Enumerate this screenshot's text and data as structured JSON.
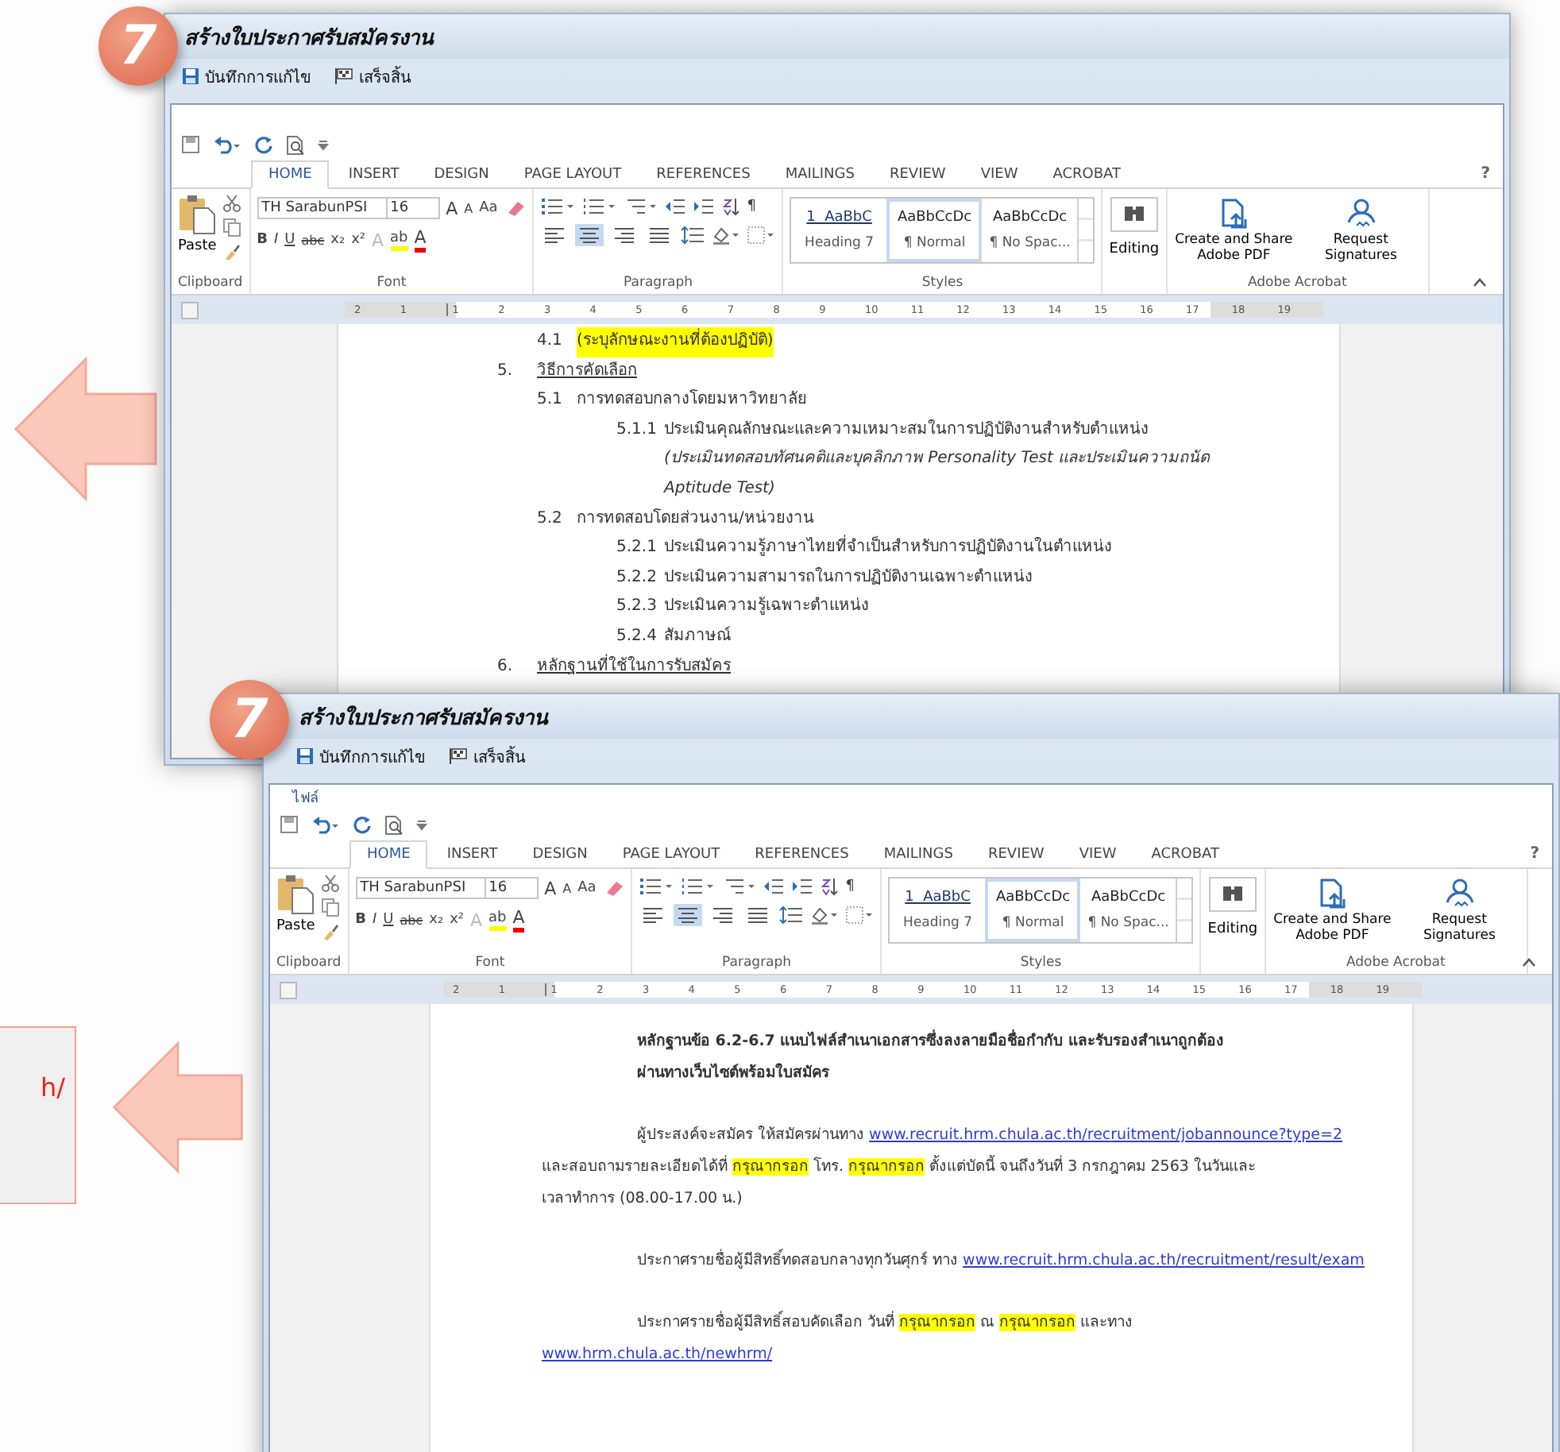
{
  "windows": [
    {
      "step": "7",
      "title": "สร้างใบประกาศรับสมัครงาน",
      "actions": [
        {
          "kind": "save",
          "label": "บันทึกการแก้ไข"
        },
        {
          "kind": "finish",
          "label": "เสร็จสิ้น"
        }
      ],
      "ribbon": {
        "help": "?",
        "tabs": [
          {
            "label": "HOME",
            "selected": true
          },
          {
            "label": "INSERT",
            "selected": false
          },
          {
            "label": "DESIGN",
            "selected": false
          },
          {
            "label": "PAGE LAYOUT",
            "selected": false
          },
          {
            "label": "REFERENCES",
            "selected": false
          },
          {
            "label": "MAILINGS",
            "selected": false
          },
          {
            "label": "REVIEW",
            "selected": false
          },
          {
            "label": "VIEW",
            "selected": false
          },
          {
            "label": "ACROBAT",
            "selected": false
          }
        ],
        "paste": "Paste",
        "font_name": "TH SarabunPSI",
        "font_size": "16",
        "grow_shrink": [
          "A",
          "A"
        ],
        "case_button": "Aa",
        "format_buttons": [
          "B",
          "I",
          "U",
          "abc",
          "x₂",
          "x²"
        ],
        "text_effects": "A",
        "highlight": "ab",
        "font_color": "A",
        "pilcrow": "¶",
        "align_buttons": [
          {
            "kind": "left",
            "selected": false
          },
          {
            "kind": "center",
            "selected": true
          },
          {
            "kind": "right",
            "selected": false
          },
          {
            "kind": "justify",
            "selected": false
          }
        ],
        "styles": [
          {
            "sample": "1  AaBbC",
            "name": "Heading 7",
            "selected": false
          },
          {
            "sample": "AaBbCcDc",
            "name": "¶ Normal",
            "selected": true
          },
          {
            "sample": "AaBbCcDc",
            "name": "¶ No Spac...",
            "selected": false
          }
        ],
        "editing": "Editing",
        "acrobat": [
          {
            "kind": "pdf",
            "label": "Create and Share Adobe PDF"
          },
          {
            "kind": "sign",
            "label": "Request Signatures"
          }
        ],
        "groups": [
          "Clipboard",
          "Font",
          "Paragraph",
          "Styles",
          "Adobe Acrobat"
        ],
        "ruler": [
          "2",
          "1",
          "1",
          "2",
          "3",
          "4",
          "5",
          "6",
          "7",
          "8",
          "9",
          "10",
          "11",
          "12",
          "13",
          "14",
          "15",
          "16",
          "17",
          "18",
          "19"
        ]
      },
      "document": {
        "kind": "outline",
        "items": [
          {
            "children": [
              {
                "num": "4.1",
                "text": "(ระบุลักษณะงานที่ต้องปฏิบัติ)",
                "highlight": true
              }
            ]
          },
          {
            "num": "5.",
            "text": "วิธีการคัดเลือก",
            "underline": true,
            "children": [
              {
                "num": "5.1",
                "text": "การทดสอบกลางโดยมหาวิทยาลัย",
                "highlight": false,
                "children": [
                  {
                    "num": "5.1.1",
                    "text": "ประเมินคุณลักษณะและความเหมาะสมในการปฏิบัติงานสำหรับตำแหน่ง",
                    "note": "(ประเมินทดสอบทัศนคติและบุคลิกภาพ Personality Test และประเมินความถนัด Aptitude Test)"
                  }
                ]
              },
              {
                "num": "5.2",
                "text": "การทดสอบโดยส่วนงาน/หน่วยงาน",
                "highlight": false,
                "children": [
                  {
                    "num": "5.2.1",
                    "text": "ประเมินความรู้ภาษาไทยที่จำเป็นสำหรับการปฏิบัติงานในตำแหน่ง"
                  },
                  {
                    "num": "5.2.2",
                    "text": "ประเมินความสามารถในการปฏิบัติงานเฉพาะตำแหน่ง"
                  },
                  {
                    "num": "5.2.3",
                    "text": "ประเมินความรู้เฉพาะตำแหน่ง"
                  },
                  {
                    "num": "5.2.4",
                    "text": "สัมภาษณ์"
                  }
                ]
              }
            ]
          },
          {
            "num": "6.",
            "text": "หลักฐานที่ใช้ในการรับสมัคร",
            "underline": true
          }
        ]
      }
    },
    {
      "step": "7",
      "title": "สร้างใบประกาศรับสมัครงาน",
      "actions": [
        {
          "kind": "save",
          "label": "บันทึกการแก้ไข"
        },
        {
          "kind": "finish",
          "label": "เสร็จสิ้น"
        }
      ],
      "file_menu": "ไฟล์",
      "ribbon": {
        "help": "?",
        "tabs": [
          {
            "label": "HOME",
            "selected": true
          },
          {
            "label": "INSERT",
            "selected": false
          },
          {
            "label": "DESIGN",
            "selected": false
          },
          {
            "label": "PAGE LAYOUT",
            "selected": false
          },
          {
            "label": "REFERENCES",
            "selected": false
          },
          {
            "label": "MAILINGS",
            "selected": false
          },
          {
            "label": "REVIEW",
            "selected": false
          },
          {
            "label": "VIEW",
            "selected": false
          },
          {
            "label": "ACROBAT",
            "selected": false
          }
        ],
        "paste": "Paste",
        "font_name": "TH SarabunPSI",
        "font_size": "16",
        "grow_shrink": [
          "A",
          "A"
        ],
        "case_button": "Aa",
        "format_buttons": [
          "B",
          "I",
          "U",
          "abc",
          "x₂",
          "x²"
        ],
        "text_effects": "A",
        "highlight": "ab",
        "font_color": "A",
        "pilcrow": "¶",
        "align_buttons": [
          {
            "kind": "left",
            "selected": false
          },
          {
            "kind": "center",
            "selected": true
          },
          {
            "kind": "right",
            "selected": false
          },
          {
            "kind": "justify",
            "selected": false
          }
        ],
        "styles": [
          {
            "sample": "1  AaBbC",
            "name": "Heading 7",
            "selected": false
          },
          {
            "sample": "AaBbCcDc",
            "name": "¶ Normal",
            "selected": true
          },
          {
            "sample": "AaBbCcDc",
            "name": "¶ No Spac...",
            "selected": false
          }
        ],
        "editing": "Editing",
        "acrobat": [
          {
            "kind": "pdf",
            "label": "Create and Share Adobe PDF"
          },
          {
            "kind": "sign",
            "label": "Request Signatures"
          }
        ],
        "groups": [
          "Clipboard",
          "Font",
          "Paragraph",
          "Styles",
          "Adobe Acrobat"
        ],
        "ruler": [
          "2",
          "1",
          "1",
          "2",
          "3",
          "4",
          "5",
          "6",
          "7",
          "8",
          "9",
          "10",
          "11",
          "12",
          "13",
          "14",
          "15",
          "16",
          "17",
          "18",
          "19"
        ]
      },
      "document": {
        "kind": "paragraphs",
        "paragraphs": [
          {
            "bold": true,
            "lines": [
              [
                {
                  "kind": "text",
                  "text": "หลักฐานข้อ 6.2-6.7 แนบไฟล์สำเนาเอกสารซึ่งลงลายมือชื่อกำกับ และรับรองสำเนาถูกต้อง"
                }
              ],
              [
                {
                  "kind": "text",
                  "text": "ผ่านทางเว็บไซต์พร้อมใบสมัคร"
                }
              ]
            ]
          },
          {
            "bold": false,
            "lines": [
              [
                {
                  "kind": "text",
                  "text": "ผู้ประสงค์จะสมัคร ให้สมัครผ่านทาง "
                },
                {
                  "kind": "link",
                  "text": "www.recruit.hrm.chula.ac.th/recruitment/jobannounce?type=2"
                }
              ],
              [
                {
                  "kind": "text",
                  "text": "และสอบถามรายละเอียดได้ที่ "
                },
                {
                  "kind": "mark",
                  "text": "กรุณากรอก"
                },
                {
                  "kind": "text",
                  "text": " โทร. "
                },
                {
                  "kind": "mark",
                  "text": "กรุณากรอก"
                },
                {
                  "kind": "text",
                  "text": " ตั้งแต่บัดนี้ จนถึงวันที่ 3 กรกฎาคม 2563 ในวันและ"
                }
              ],
              [
                {
                  "kind": "text",
                  "text": "เวลาทำการ (08.00-17.00 น.)"
                }
              ]
            ]
          },
          {
            "bold": false,
            "lines": [
              [
                {
                  "kind": "text",
                  "text": "ประกาศรายชื่อผู้มีสิทธิ์ทดสอบกลางทุกวันศุกร์ ทาง "
                },
                {
                  "kind": "link",
                  "text": "www.recruit.hrm.chula.ac.th/recruitment/result/exam"
                }
              ]
            ]
          },
          {
            "bold": false,
            "lines": [
              [
                {
                  "kind": "text",
                  "text": "ประกาศรายชื่อผู้มีสิทธิ์สอบคัดเลือก วันที่ "
                },
                {
                  "kind": "mark",
                  "text": "กรุณากรอก"
                },
                {
                  "kind": "text",
                  "text": " ณ "
                },
                {
                  "kind": "mark",
                  "text": "กรุณากรอก"
                },
                {
                  "kind": "text",
                  "text": " และทาง"
                }
              ],
              [
                {
                  "kind": "link",
                  "text": "www.hrm.chula.ac.th/newhrm/"
                }
              ]
            ]
          }
        ]
      }
    }
  ],
  "callout": {
    "text": "h/"
  }
}
